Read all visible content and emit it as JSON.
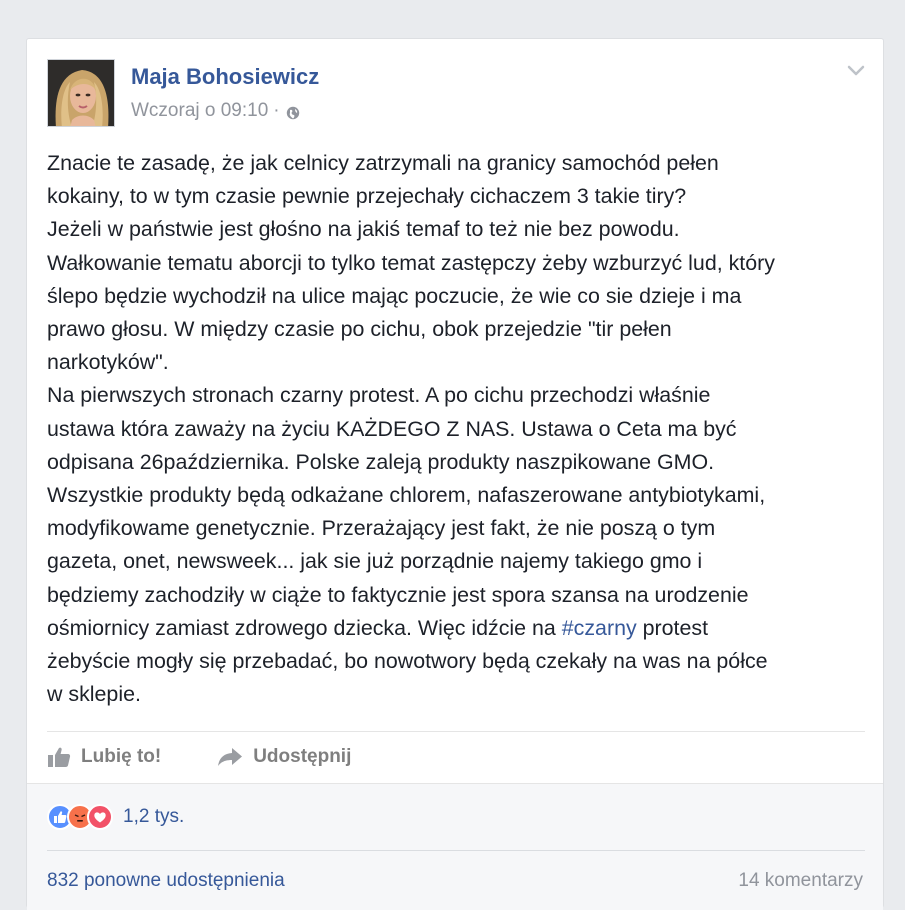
{
  "post": {
    "author": "Maja Bohosiewicz",
    "timestamp": "Wczoraj o 09:10",
    "separator": "·",
    "privacy_icon": "globe-icon",
    "menu_icon": "chevron-down-icon",
    "text_lines": [
      "Znacie te zasadę, że jak celnicy zatrzymali na granicy samochód pełen",
      "kokainy, to w tym czasie pewnie przejechały cichaczem 3 takie tiry?",
      "Jeżeli w państwie jest głośno na jakiś temaf to też nie bez powodu.",
      "Wałkowanie tematu aborcji to tylko temat zastępczy żeby wzburzyć lud, który",
      "ślepo będzie wychodził na ulice mając poczucie, że wie co sie dzieje i ma",
      "prawo głosu. W między czasie po cichu, obok przejedzie \"tir pełen",
      "narkotyków\".",
      "Na pierwszych stronach czarny protest. A po cichu przechodzi właśnie",
      "ustawa która zaważy na życiu KAŻDEGO Z NAS. Ustawa o Ceta ma być",
      "odpisana 26października. Polske zaleją produkty naszpikowane GMO.",
      "Wszystkie produkty będą odkażane chlorem, nafaszerowane antybiotykami,",
      "modyfikowame genetycznie. Przerażający jest fakt, że nie poszą o tym",
      "gazeta, onet, newsweek... jak sie już porządnie najemy takiego gmo i",
      "będziemy zachodziły w ciąże to faktycznie jest spora szansa na urodzenie"
    ],
    "line_15_before": "ośmiornicy zamiast zdrowego dziecka. Więc idźcie na ",
    "hashtag": "#czarny",
    "line_15_after": " protest",
    "text_lines_end": [
      "żebyście mogły się przebadać, bo nowotwory będą czekały na was na półce",
      "w sklepie."
    ]
  },
  "actions": {
    "like_label": "Lubię to!",
    "like_icon": "thumbs-up-icon",
    "share_label": "Udostępnij",
    "share_icon": "share-arrow-icon"
  },
  "stats": {
    "reactions": [
      {
        "icon": "like-reaction-icon",
        "color": "#5890ff"
      },
      {
        "icon": "angry-reaction-icon",
        "color": "#f7714b"
      },
      {
        "icon": "love-reaction-icon",
        "color": "#f25268"
      }
    ],
    "reaction_count": "1,2 tys.",
    "shares": "832 ponowne udostępnienia",
    "comments": "14 komentarzy"
  },
  "colors": {
    "link": "#365899",
    "text": "#1d2129",
    "muted": "#90949c",
    "background": "#e9ebee"
  }
}
